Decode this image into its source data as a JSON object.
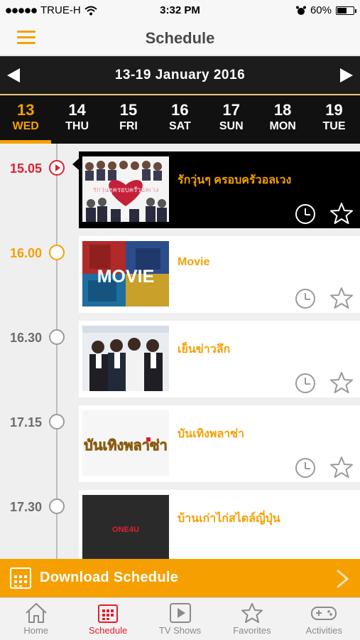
{
  "status_bar": {
    "carrier": "TRUE-H",
    "time": "3:32 PM",
    "battery": "60%",
    "battery_level": 0.6
  },
  "nav": {
    "title": "Schedule"
  },
  "week": {
    "label": "13-19  January  2016"
  },
  "days": [
    {
      "num": "13",
      "name": "WED",
      "active": true
    },
    {
      "num": "14",
      "name": "THU"
    },
    {
      "num": "15",
      "name": "FRI"
    },
    {
      "num": "16",
      "name": "SAT"
    },
    {
      "num": "17",
      "name": "SUN"
    },
    {
      "num": "18",
      "name": "MON"
    },
    {
      "num": "19",
      "name": "TUE"
    }
  ],
  "programs": [
    {
      "time": "15.05",
      "title": "รักวุ่นๆ ครอบครัวอลเวง",
      "thumb_text": "รักวุ่นๆครอบครัวอลเวง"
    },
    {
      "time": "16.00",
      "title": "Movie",
      "thumb_text": "MOVIE"
    },
    {
      "time": "16.30",
      "title": "เย็นข่าวลึก"
    },
    {
      "time": "17.15",
      "title": "บันเทิงพลาซ่า",
      "thumb_text": "บันเทิงพลาซ่า"
    },
    {
      "time": "17.30",
      "title": "บ้านเก่าไก่สไตล์ญี่ปุ่น",
      "thumb_text": "ONE4U"
    }
  ],
  "download": {
    "label": "Download  Schedule"
  },
  "tabs": [
    {
      "label": "Home",
      "icon": "home-icon"
    },
    {
      "label": "Schedule",
      "icon": "calendar-icon",
      "active": true
    },
    {
      "label": "TV Shows",
      "icon": "play-icon"
    },
    {
      "label": "Favorites",
      "icon": "star-icon"
    },
    {
      "label": "Activities",
      "icon": "gamepad-icon"
    }
  ],
  "colors": {
    "accent": "#f5a000",
    "live": "#e0202f",
    "header": "#1c1c1c"
  }
}
